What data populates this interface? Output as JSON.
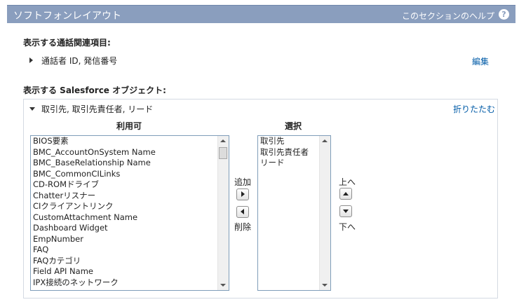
{
  "header": {
    "title": "ソフトフォンレイアウト",
    "help_link": "このセクションのヘルプ",
    "help_icon": "question-icon"
  },
  "call_related": {
    "heading": "表示する通話関連項目:",
    "value": "通話者 ID, 発信番号",
    "edit": "編集"
  },
  "objects": {
    "heading": "表示する Salesforce オブジェクト:",
    "selected_summary": "取引先, 取引先責任者, リード",
    "collapse": "折りたたむ",
    "available_header": "利用可",
    "selected_header": "選択",
    "available_items": [
      "BIOS要素",
      "BMC_AccountOnSystem Name",
      "BMC_BaseRelationship Name",
      "BMC_CommonCILinks",
      "CD-ROMドライブ",
      "Chatterリスナー",
      "CIクライアントリンク",
      "CustomAttachment Name",
      "Dashboard Widget",
      "EmpNumber",
      "FAQ",
      "FAQカテゴリ",
      "Field API Name",
      "IPX接続のネットワーク"
    ],
    "selected_items": [
      "取引先",
      "取引先責任者",
      "リード"
    ],
    "add_label": "追加",
    "remove_label": "削除",
    "up_label": "上へ",
    "down_label": "下へ"
  }
}
